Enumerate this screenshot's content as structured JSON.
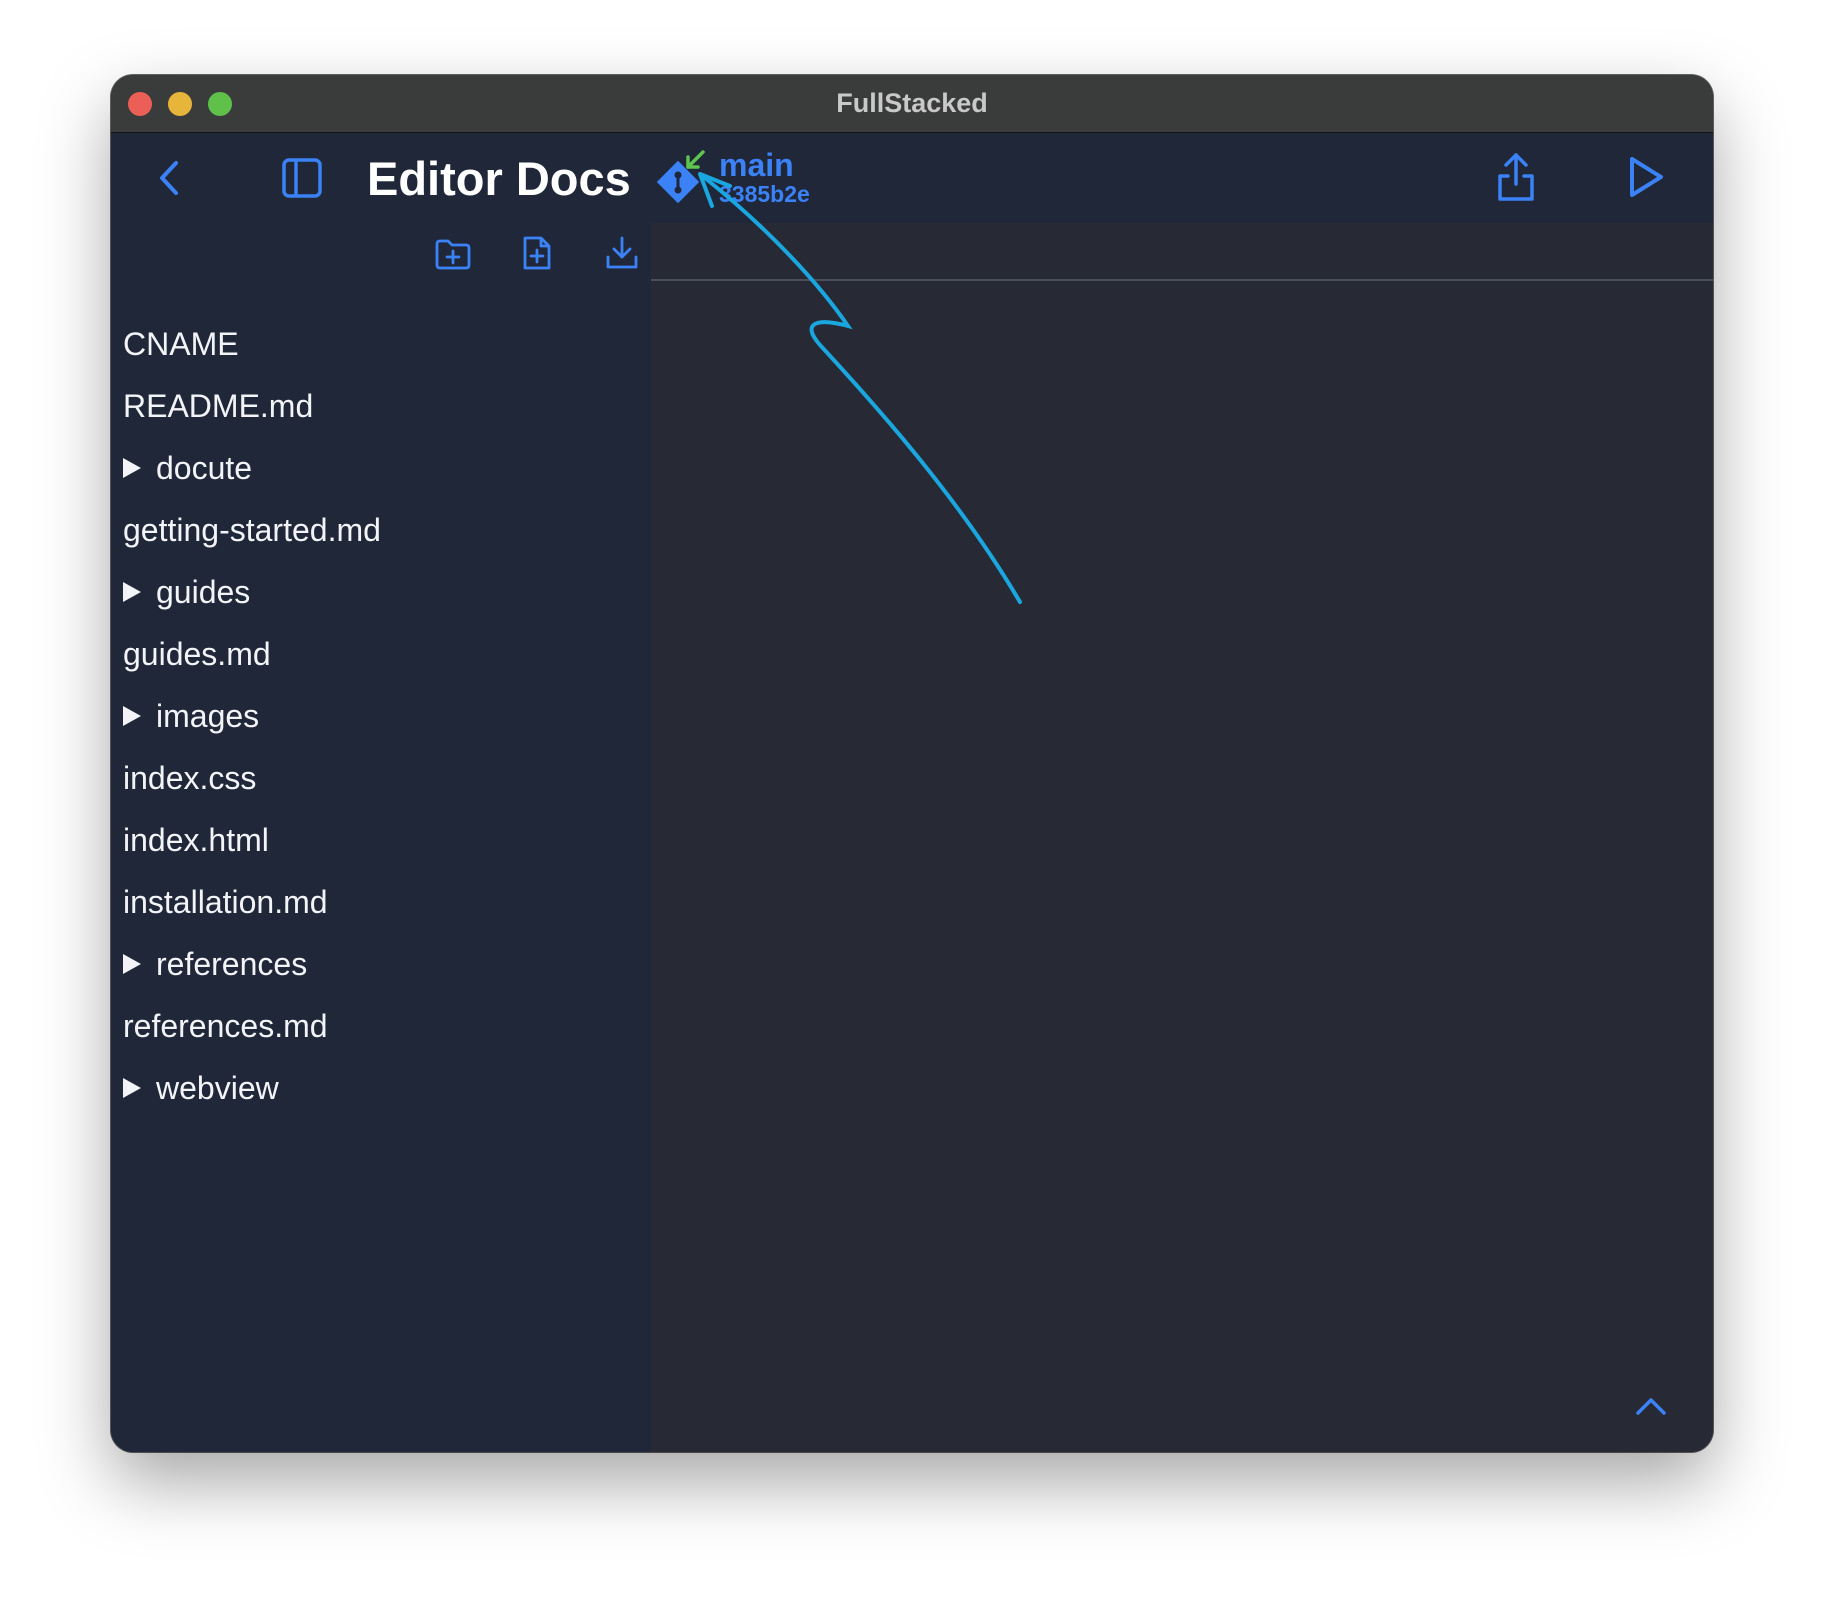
{
  "window": {
    "title": "FullStacked"
  },
  "toolbar": {
    "back_icon": "chevron-left-icon",
    "sidebar_toggle_icon": "sidebar-toggle-icon",
    "project_title": "Editor Docs",
    "git": {
      "icon": "git-icon",
      "status_icon": "arrow-down-left-icon",
      "branch": "main",
      "commit": "3385b2e"
    },
    "share_icon": "share-icon",
    "run_icon": "play-icon"
  },
  "sidebar": {
    "actions": [
      "new-folder-icon",
      "new-file-icon",
      "import-icon"
    ],
    "files": [
      {
        "name": "CNAME",
        "type": "file"
      },
      {
        "name": "README.md",
        "type": "file"
      },
      {
        "name": "docute",
        "type": "folder"
      },
      {
        "name": "getting-started.md",
        "type": "file"
      },
      {
        "name": "guides",
        "type": "folder"
      },
      {
        "name": "guides.md",
        "type": "file"
      },
      {
        "name": "images",
        "type": "folder"
      },
      {
        "name": "index.css",
        "type": "file"
      },
      {
        "name": "index.html",
        "type": "file"
      },
      {
        "name": "installation.md",
        "type": "file"
      },
      {
        "name": "references",
        "type": "folder"
      },
      {
        "name": "references.md",
        "type": "file"
      },
      {
        "name": "webview",
        "type": "folder"
      }
    ]
  },
  "editor": {
    "collapse_icon": "chevron-up-icon"
  },
  "colors": {
    "accent": "#3b82f6",
    "sidebar_bg": "#1f2739",
    "editor_bg": "#272a34",
    "titlebar_bg": "#3a3b3b",
    "annotation_arrow": "#1aa7e0",
    "git_status": "#5cc44f"
  }
}
